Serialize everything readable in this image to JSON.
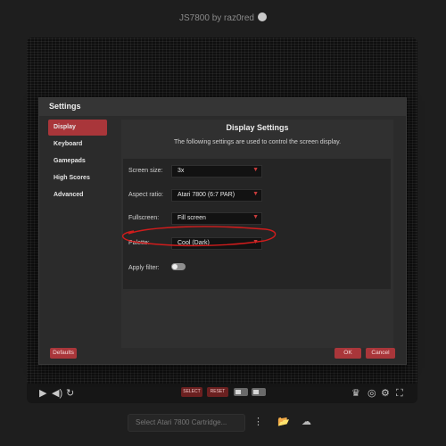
{
  "app": {
    "title": "JS7800 by raz0red",
    "github_icon": "github-icon"
  },
  "settings_dialog": {
    "title": "Settings",
    "tabs": [
      {
        "label": "Display",
        "active": true
      },
      {
        "label": "Keyboard",
        "active": false
      },
      {
        "label": "Gamepads",
        "active": false
      },
      {
        "label": "High Scores",
        "active": false
      },
      {
        "label": "Advanced",
        "active": false
      }
    ],
    "panel": {
      "title": "Display Settings",
      "description": "The following settings are used to control the screen display.",
      "screen_size": {
        "label": "Screen size:",
        "value": "3x"
      },
      "aspect_ratio": {
        "label": "Aspect ratio:",
        "value": "Atari 7800 (6:7 PAR)"
      },
      "fullscreen": {
        "label": "Fullscreen:",
        "value": "Fill screen"
      },
      "palette": {
        "label": "Palette:",
        "value": "Cool (Dark)"
      },
      "apply_filter": {
        "label": "Apply filter:",
        "enabled": false
      }
    },
    "buttons": {
      "defaults": "Defaults",
      "ok": "OK",
      "cancel": "Cancel"
    }
  },
  "emulator_controls": {
    "select_label": "SELECT",
    "reset_label": "RESET",
    "icons": [
      "play-icon",
      "volume-icon",
      "restart-icon",
      "trophy-icon",
      "gamepad-icon",
      "gear-icon",
      "fullscreen-icon"
    ]
  },
  "cartridge": {
    "placeholder": "Select Atari 7800 Cartridge..."
  },
  "colors": {
    "accent": "#a9363a",
    "annotation": "#d11c1c",
    "background": "#1e1e1e"
  }
}
